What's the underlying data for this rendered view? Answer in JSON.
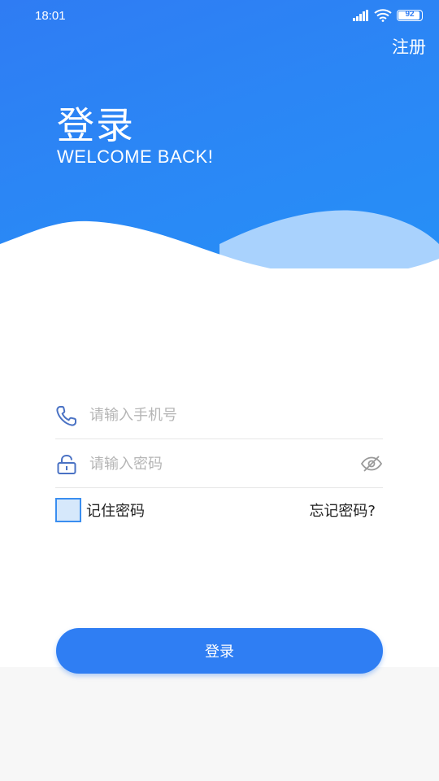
{
  "status_bar": {
    "time": "18:01",
    "battery": "92"
  },
  "header": {
    "register_label": "注册",
    "title": "登录",
    "subtitle": "WELCOME BACK!"
  },
  "form": {
    "phone_placeholder": "请输入手机号",
    "password_placeholder": "请输入密码",
    "remember_label": "记住密码",
    "remember_checked": false,
    "forgot_label": "忘记密码?",
    "login_label": "登录"
  },
  "colors": {
    "primary": "#2f7ef3",
    "wave_light": "#a9d2fd",
    "checkbox_fill": "#d6e8fb"
  },
  "icons": [
    "signal-icon",
    "wifi-icon",
    "battery-icon",
    "phone-icon",
    "lock-icon",
    "eye-hidden-icon"
  ]
}
